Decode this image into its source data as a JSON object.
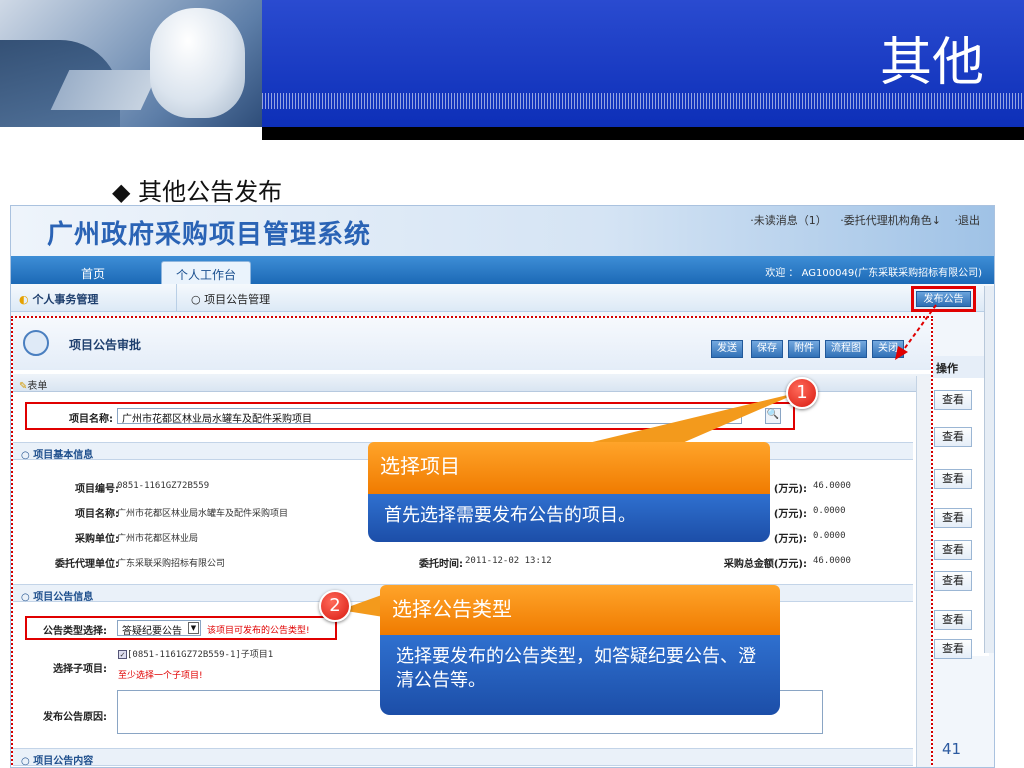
{
  "slide": {
    "title": "其他",
    "bullet": "其他公告发布",
    "page_number": "41"
  },
  "app": {
    "title": "广州政府采购项目管理系统",
    "toplinks": [
      "·未读消息（1）",
      "·委托代理机构角色↓",
      "·退出"
    ],
    "nav": {
      "home": "首页",
      "personal": "个人工作台"
    },
    "welcome": "欢迎 ： AG100049(广东采联采购招标有限公司)",
    "side_title": "个人事务管理",
    "breadcrumb": "项目公告管理",
    "publish_button": "发布公告",
    "list_header": "操作",
    "view_label": "查看"
  },
  "dialog": {
    "title": "项目公告审批",
    "buttons": [
      "发送",
      "保存",
      "附件",
      "流程图",
      "关闭"
    ],
    "form_label": "表单",
    "project_name_label": "项目名称:",
    "project_name_value": "广州市花都区林业局水罐车及配件采购项目",
    "section_basic": "项目基本信息",
    "basic": {
      "code_label": "项目编号:",
      "code_value": "0851-1161GZ72B559",
      "name_label": "项目名称:",
      "name_value": "广州市花都区林业局水罐车及配件采购项目",
      "unit_label": "采购单位:",
      "unit_value": "广州市花都区林业局",
      "agent_label": "委托代理单位:",
      "agent_value": "广东采联采购招标有限公司",
      "time_label": "委托时间:",
      "time_value": "2011-12-02 13:12",
      "amt1_label": "(万元):",
      "amt1_value": "46.0000",
      "amt2_label": "(万元):",
      "amt2_value": "0.0000",
      "amt3_label": "(万元):",
      "amt3_value": "0.0000",
      "total_label": "采购总金额(万元):",
      "total_value": "46.0000"
    },
    "section_notice": "项目公告信息",
    "type_label": "公告类型选择:",
    "type_value": "答疑纪要公告",
    "type_hint": "该项目可发布的公告类型!",
    "sub_label": "选择子项目:",
    "sub_value": "[0851-1161GZ72B559-1]子项目1",
    "sub_hint": "至少选择一个子项目!",
    "reason_label": "发布公告原因:",
    "section_content": "项目公告内容"
  },
  "callouts": [
    {
      "num": "1",
      "title": "选择项目",
      "body": "首先选择需要发布公告的项目。"
    },
    {
      "num": "2",
      "title": "选择公告类型",
      "body": "选择要发布的公告类型，如答疑纪要公告、澄清公告等。"
    }
  ]
}
